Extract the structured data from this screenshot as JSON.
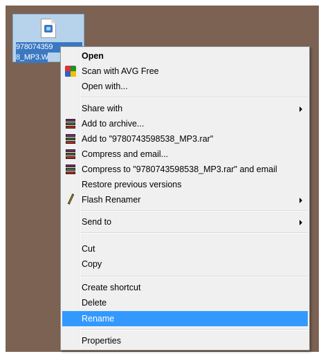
{
  "desktop": {
    "file": {
      "label_line1": "978074359",
      "label_line2": "8_MP3.W"
    }
  },
  "context_menu": {
    "open": "Open",
    "scan_avg": "Scan with AVG Free",
    "open_with": "Open with...",
    "share_with": "Share with",
    "add_to_archive": "Add to archive...",
    "add_to_rar": "Add to \"9780743598538_MP3.rar\"",
    "compress_email": "Compress and email...",
    "compress_rar_email": "Compress to \"9780743598538_MP3.rar\" and email",
    "restore_versions": "Restore previous versions",
    "flash_renamer": "Flash Renamer",
    "send_to": "Send to",
    "cut": "Cut",
    "copy": "Copy",
    "create_shortcut": "Create shortcut",
    "delete": "Delete",
    "rename": "Rename",
    "properties": "Properties"
  },
  "colors": {
    "desktop": "#7b6252",
    "menu_bg": "#f0f0f0",
    "highlight": "#3399ff",
    "file_selection": "#3a78c2"
  },
  "icons": {
    "file": "audio-file-icon",
    "avg": "avg-icon",
    "rar": "winrar-icon",
    "flash_renamer": "pen-icon",
    "submenu": "submenu-arrow-icon"
  }
}
